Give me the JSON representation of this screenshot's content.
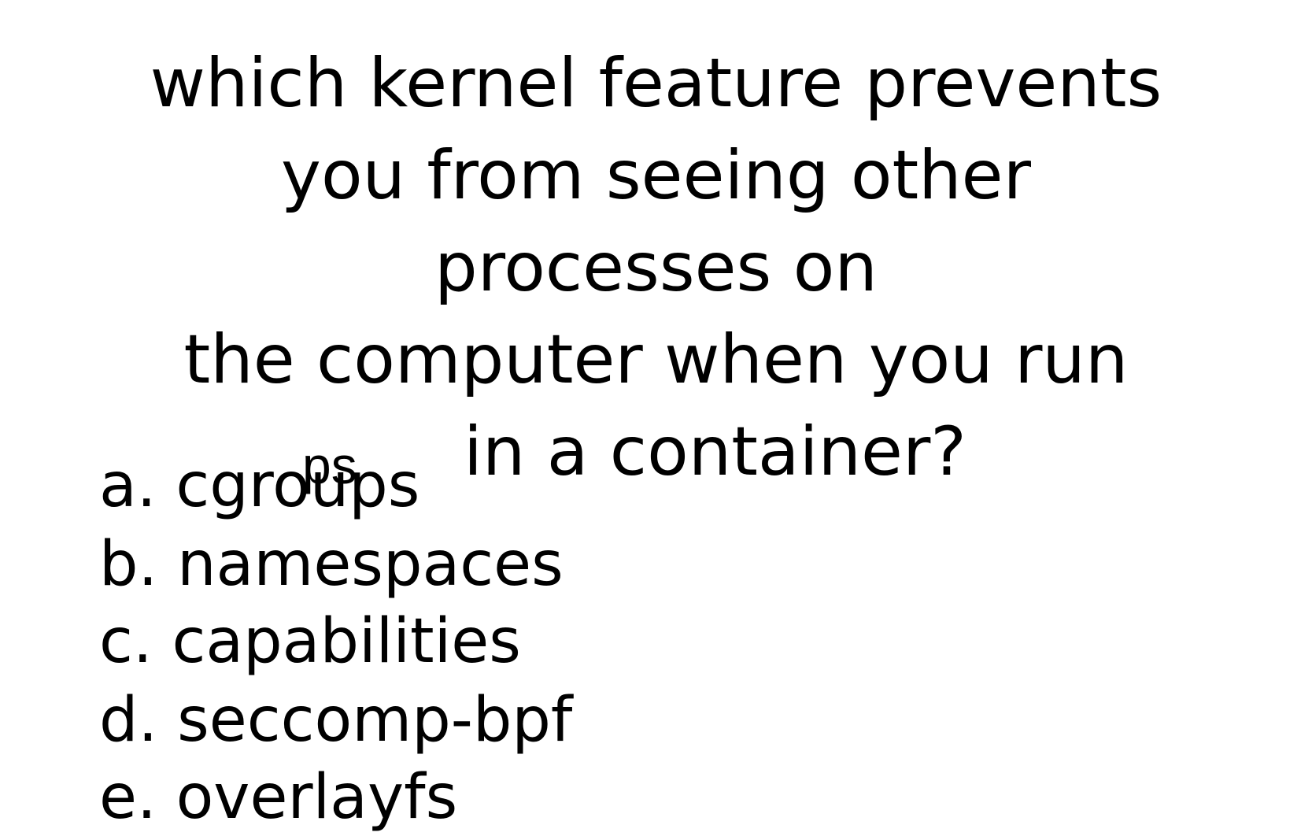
{
  "question": {
    "lines": [
      "which kernel feature prevents",
      "you from seeing other",
      "processes on",
      "the computer when you run",
      "in a container?"
    ],
    "command": "ps"
  },
  "options": [
    "a. cgroups",
    "b. namespaces",
    "c. capabilities",
    "d. seccomp-bpf",
    "e. overlayfs"
  ]
}
